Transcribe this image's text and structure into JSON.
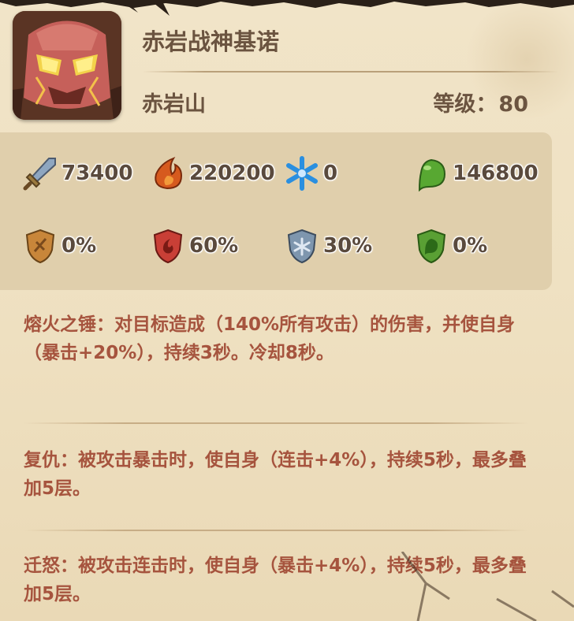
{
  "hero": {
    "name": "赤岩战神基诺",
    "place": "赤岩山",
    "level_label": "等级：",
    "level_value": "80"
  },
  "stats": {
    "attack": "73400",
    "fire": "220200",
    "ice": "0",
    "poison": "146800",
    "physical_resist": "0%",
    "fire_resist": "60%",
    "ice_resist": "30%",
    "poison_resist": "0%"
  },
  "skills": [
    {
      "text": "熔火之锤：对目标造成（140%所有攻击）的伤害，并使自身（暴击+20%），持续3秒。冷却8秒。"
    },
    {
      "text": "复仇：被攻击暴击时，使自身（连击+4%），持续5秒，最多叠加5层。"
    },
    {
      "text": "迁怒：被攻击连击时，使自身（暴击+4%），持续5秒，最多叠加5层。"
    }
  ],
  "colors": {
    "background": "#efe1c2",
    "stat_panel": "#e0cfac",
    "name_text": "#6b5440",
    "skill_text": "#a6543e"
  },
  "icons": {
    "attack": "sword-icon",
    "fire": "fire-icon",
    "ice": "snowflake-icon",
    "poison": "poison-drop-icon",
    "physical_resist": "bronze-shield-icon",
    "fire_resist": "fire-shield-icon",
    "ice_resist": "ice-shield-icon",
    "poison_resist": "poison-shield-icon"
  }
}
